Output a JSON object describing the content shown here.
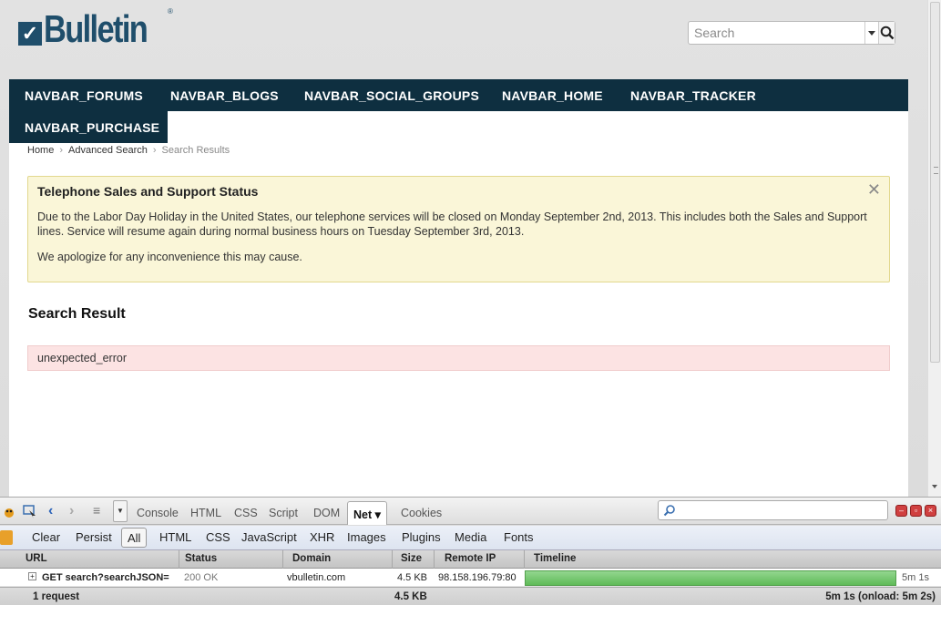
{
  "logo": {
    "check": "✓",
    "text": "Bulletin",
    "reg": "®"
  },
  "search": {
    "placeholder": "Search"
  },
  "navbar": {
    "items": [
      "NAVBAR_FORUMS",
      "NAVBAR_BLOGS",
      "NAVBAR_SOCIAL_GROUPS",
      "NAVBAR_HOME",
      "NAVBAR_TRACKER",
      "NAVBAR_PURCHASE"
    ]
  },
  "breadcrumb": {
    "home": "Home",
    "advanced": "Advanced Search",
    "current": "Search Results"
  },
  "notice": {
    "title": "Telephone Sales and Support Status",
    "close": "✕",
    "body": "Due to the Labor Day Holiday in the United States, our telephone services will be closed on Monday September 2nd, 2013. This includes both the Sales and Support lines. Service will resume again during normal business hours on Tuesday September 3rd, 2013.",
    "body2": "We apologize for any inconvenience this may cause."
  },
  "search_result": {
    "title": "Search Result",
    "error": "unexpected_error"
  },
  "firebug": {
    "tabs": [
      "Console",
      "HTML",
      "CSS",
      "Script",
      "DOM",
      "Net ▾",
      "Cookies"
    ],
    "net_buttons": [
      "Clear",
      "Persist",
      "All",
      "HTML",
      "CSS",
      "JavaScript",
      "XHR",
      "Images",
      "Plugins",
      "Media",
      "Fonts"
    ],
    "columns": {
      "url": "URL",
      "status": "Status",
      "domain": "Domain",
      "size": "Size",
      "remote_ip": "Remote IP",
      "timeline": "Timeline"
    },
    "request": {
      "url": "GET search?searchJSON=",
      "status": "200 OK",
      "domain": "vbulletin.com",
      "size": "4.5 KB",
      "remote_ip": "98.158.196.79:80",
      "time": "5m 1s"
    },
    "footer": {
      "count": "1 request",
      "size": "4.5 KB",
      "total": "5m 1s (onload: 5m 2s)"
    }
  },
  "colors": {
    "navbar": "#0e2f40",
    "notice_bg": "#faf6d8",
    "error_bg": "#fce3e3",
    "timeline": "#5fbb58"
  }
}
